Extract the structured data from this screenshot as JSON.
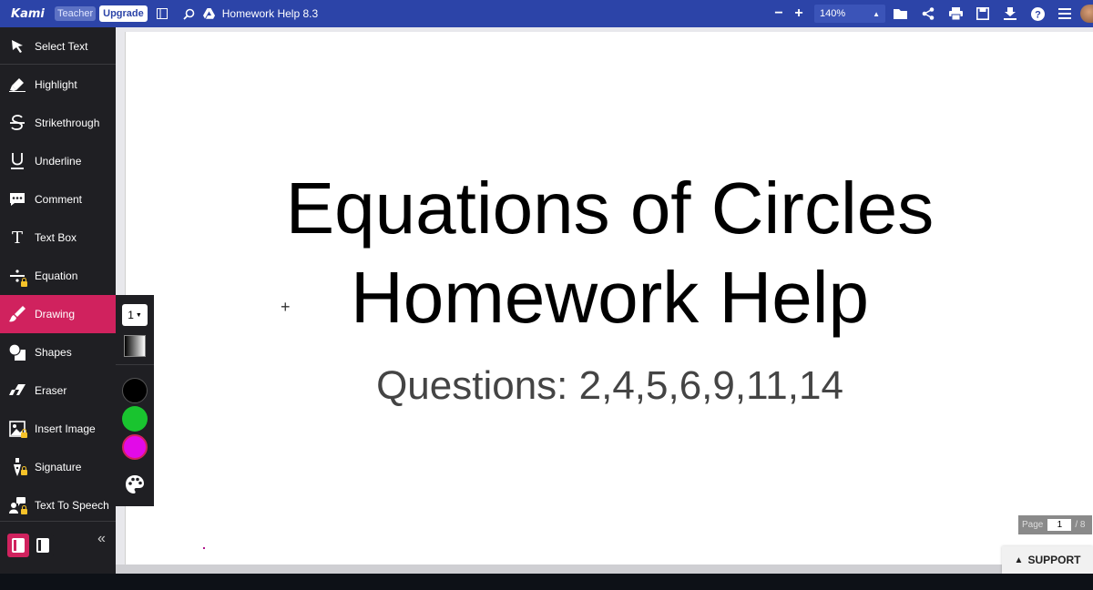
{
  "topbar": {
    "logo": "Kami",
    "teacher_badge": "Teacher",
    "upgrade_label": "Upgrade",
    "doc_title": "Homework Help 8.3",
    "zoom_minus": "−",
    "zoom_plus": "+",
    "zoom_value": "140%",
    "icons": [
      "sidebar-toggle-icon",
      "search-icon",
      "drive-icon",
      "folder-icon",
      "share-icon",
      "print-icon",
      "save-icon",
      "download-icon",
      "help-icon",
      "menu-icon"
    ]
  },
  "sidebar": {
    "tools": [
      {
        "label": "Select Text",
        "icon": "cursor-icon"
      },
      {
        "label": "Highlight",
        "icon": "highlighter-icon"
      },
      {
        "label": "Strikethrough",
        "icon": "strikethrough-icon"
      },
      {
        "label": "Underline",
        "icon": "underline-icon"
      },
      {
        "label": "Comment",
        "icon": "comment-icon"
      },
      {
        "label": "Text Box",
        "icon": "text-icon"
      },
      {
        "label": "Equation",
        "icon": "divide-icon"
      },
      {
        "label": "Drawing",
        "icon": "brush-icon"
      },
      {
        "label": "Shapes",
        "icon": "shapes-icon"
      },
      {
        "label": "Eraser",
        "icon": "eraser-icon"
      },
      {
        "label": "Insert Image",
        "icon": "image-icon"
      },
      {
        "label": "Signature",
        "icon": "pen-nib-icon"
      },
      {
        "label": "Text To Speech",
        "icon": "speech-icon"
      }
    ],
    "collapse_glyph": "«"
  },
  "drawing_panel": {
    "stroke_width": "1",
    "colors": {
      "black": "#000000",
      "green": "#19c42f",
      "magenta": "#e20ae8"
    },
    "accent": "#d0225e"
  },
  "document": {
    "title_line1": "Equations of Circles",
    "title_line2": "Homework Help",
    "questions": "Questions: 2,4,5,6,9,11,14"
  },
  "pager": {
    "label": "Page",
    "current": "1",
    "total": "/ 8"
  },
  "support_label": "SUPPORT"
}
